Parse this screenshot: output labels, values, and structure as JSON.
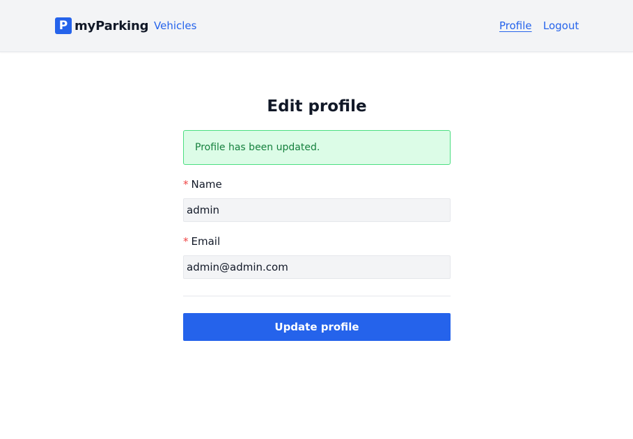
{
  "nav": {
    "brand_logo_letter": "P",
    "brand_name": "myParking",
    "links": {
      "vehicles": "Vehicles",
      "profile": "Profile",
      "logout": "Logout"
    }
  },
  "page": {
    "title": "Edit profile",
    "alert": "Profile has been updated."
  },
  "form": {
    "required_marker": "*",
    "name": {
      "label": "Name",
      "value": "admin"
    },
    "email": {
      "label": "Email",
      "value": "admin@admin.com"
    },
    "submit_label": "Update profile"
  },
  "colors": {
    "accent": "#2563eb",
    "success_bg": "#dcfce7",
    "success_border": "#4ade80",
    "success_text": "#15803d",
    "required": "#ef4444"
  }
}
